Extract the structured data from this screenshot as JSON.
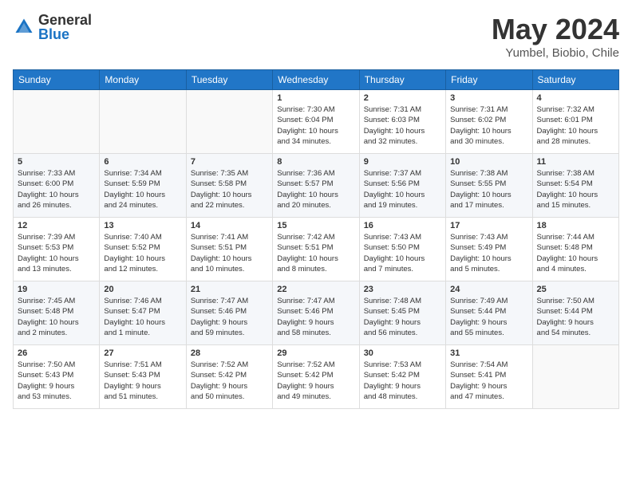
{
  "header": {
    "logo_general": "General",
    "logo_blue": "Blue",
    "title": "May 2024",
    "location": "Yumbel, Biobio, Chile"
  },
  "days_of_week": [
    "Sunday",
    "Monday",
    "Tuesday",
    "Wednesday",
    "Thursday",
    "Friday",
    "Saturday"
  ],
  "weeks": [
    [
      {
        "num": "",
        "info": ""
      },
      {
        "num": "",
        "info": ""
      },
      {
        "num": "",
        "info": ""
      },
      {
        "num": "1",
        "info": "Sunrise: 7:30 AM\nSunset: 6:04 PM\nDaylight: 10 hours\nand 34 minutes."
      },
      {
        "num": "2",
        "info": "Sunrise: 7:31 AM\nSunset: 6:03 PM\nDaylight: 10 hours\nand 32 minutes."
      },
      {
        "num": "3",
        "info": "Sunrise: 7:31 AM\nSunset: 6:02 PM\nDaylight: 10 hours\nand 30 minutes."
      },
      {
        "num": "4",
        "info": "Sunrise: 7:32 AM\nSunset: 6:01 PM\nDaylight: 10 hours\nand 28 minutes."
      }
    ],
    [
      {
        "num": "5",
        "info": "Sunrise: 7:33 AM\nSunset: 6:00 PM\nDaylight: 10 hours\nand 26 minutes."
      },
      {
        "num": "6",
        "info": "Sunrise: 7:34 AM\nSunset: 5:59 PM\nDaylight: 10 hours\nand 24 minutes."
      },
      {
        "num": "7",
        "info": "Sunrise: 7:35 AM\nSunset: 5:58 PM\nDaylight: 10 hours\nand 22 minutes."
      },
      {
        "num": "8",
        "info": "Sunrise: 7:36 AM\nSunset: 5:57 PM\nDaylight: 10 hours\nand 20 minutes."
      },
      {
        "num": "9",
        "info": "Sunrise: 7:37 AM\nSunset: 5:56 PM\nDaylight: 10 hours\nand 19 minutes."
      },
      {
        "num": "10",
        "info": "Sunrise: 7:38 AM\nSunset: 5:55 PM\nDaylight: 10 hours\nand 17 minutes."
      },
      {
        "num": "11",
        "info": "Sunrise: 7:38 AM\nSunset: 5:54 PM\nDaylight: 10 hours\nand 15 minutes."
      }
    ],
    [
      {
        "num": "12",
        "info": "Sunrise: 7:39 AM\nSunset: 5:53 PM\nDaylight: 10 hours\nand 13 minutes."
      },
      {
        "num": "13",
        "info": "Sunrise: 7:40 AM\nSunset: 5:52 PM\nDaylight: 10 hours\nand 12 minutes."
      },
      {
        "num": "14",
        "info": "Sunrise: 7:41 AM\nSunset: 5:51 PM\nDaylight: 10 hours\nand 10 minutes."
      },
      {
        "num": "15",
        "info": "Sunrise: 7:42 AM\nSunset: 5:51 PM\nDaylight: 10 hours\nand 8 minutes."
      },
      {
        "num": "16",
        "info": "Sunrise: 7:43 AM\nSunset: 5:50 PM\nDaylight: 10 hours\nand 7 minutes."
      },
      {
        "num": "17",
        "info": "Sunrise: 7:43 AM\nSunset: 5:49 PM\nDaylight: 10 hours\nand 5 minutes."
      },
      {
        "num": "18",
        "info": "Sunrise: 7:44 AM\nSunset: 5:48 PM\nDaylight: 10 hours\nand 4 minutes."
      }
    ],
    [
      {
        "num": "19",
        "info": "Sunrise: 7:45 AM\nSunset: 5:48 PM\nDaylight: 10 hours\nand 2 minutes."
      },
      {
        "num": "20",
        "info": "Sunrise: 7:46 AM\nSunset: 5:47 PM\nDaylight: 10 hours\nand 1 minute."
      },
      {
        "num": "21",
        "info": "Sunrise: 7:47 AM\nSunset: 5:46 PM\nDaylight: 9 hours\nand 59 minutes."
      },
      {
        "num": "22",
        "info": "Sunrise: 7:47 AM\nSunset: 5:46 PM\nDaylight: 9 hours\nand 58 minutes."
      },
      {
        "num": "23",
        "info": "Sunrise: 7:48 AM\nSunset: 5:45 PM\nDaylight: 9 hours\nand 56 minutes."
      },
      {
        "num": "24",
        "info": "Sunrise: 7:49 AM\nSunset: 5:44 PM\nDaylight: 9 hours\nand 55 minutes."
      },
      {
        "num": "25",
        "info": "Sunrise: 7:50 AM\nSunset: 5:44 PM\nDaylight: 9 hours\nand 54 minutes."
      }
    ],
    [
      {
        "num": "26",
        "info": "Sunrise: 7:50 AM\nSunset: 5:43 PM\nDaylight: 9 hours\nand 53 minutes."
      },
      {
        "num": "27",
        "info": "Sunrise: 7:51 AM\nSunset: 5:43 PM\nDaylight: 9 hours\nand 51 minutes."
      },
      {
        "num": "28",
        "info": "Sunrise: 7:52 AM\nSunset: 5:42 PM\nDaylight: 9 hours\nand 50 minutes."
      },
      {
        "num": "29",
        "info": "Sunrise: 7:52 AM\nSunset: 5:42 PM\nDaylight: 9 hours\nand 49 minutes."
      },
      {
        "num": "30",
        "info": "Sunrise: 7:53 AM\nSunset: 5:42 PM\nDaylight: 9 hours\nand 48 minutes."
      },
      {
        "num": "31",
        "info": "Sunrise: 7:54 AM\nSunset: 5:41 PM\nDaylight: 9 hours\nand 47 minutes."
      },
      {
        "num": "",
        "info": ""
      }
    ]
  ]
}
